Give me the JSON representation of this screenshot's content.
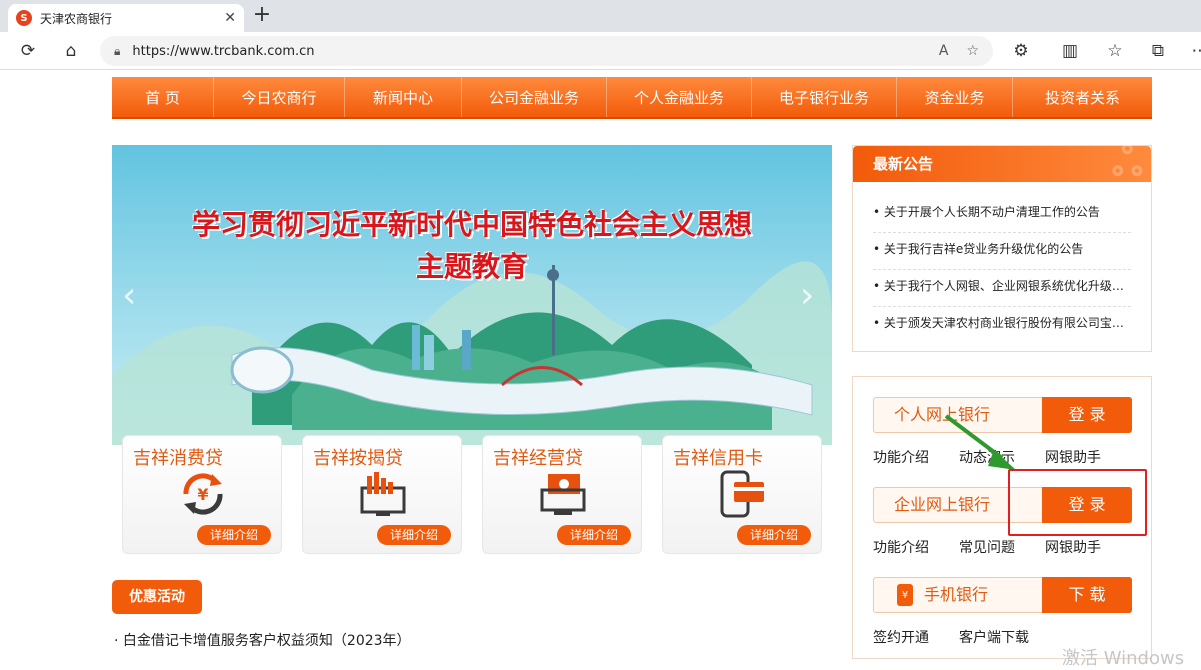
{
  "browser": {
    "tab_title": "天津农商银行",
    "url": "https://www.trcbank.com.cn",
    "icons": [
      "back-icon",
      "reload-icon",
      "home-icon",
      "lock-icon",
      "read-aloud-icon",
      "favorite-icon",
      "extensions-icon",
      "split-icon",
      "favorites-icon",
      "collections-icon"
    ]
  },
  "nav": {
    "items": [
      "首 页",
      "今日农商行",
      "新闻中心",
      "公司金融业务",
      "个人金融业务",
      "电子银行业务",
      "资金业务",
      "投资者关系"
    ]
  },
  "banner": {
    "title_line1": "学习贯彻习近平新时代中国特色社会主义思想",
    "title_line2": "主题教育"
  },
  "products": [
    {
      "name": "吉祥消费贷",
      "button": "详细介绍",
      "icon": "yen-cycle-icon"
    },
    {
      "name": "吉祥按揭贷",
      "button": "详细介绍",
      "icon": "building-monitor-icon"
    },
    {
      "name": "吉祥经营贷",
      "button": "详细介绍",
      "icon": "cash-register-icon"
    },
    {
      "name": "吉祥信用卡",
      "button": "详细介绍",
      "icon": "phone-card-icon"
    }
  ],
  "promo": {
    "tag": "优惠活动",
    "items": [
      "白金借记卡增值服务客户权益须知（2023年）"
    ]
  },
  "notice": {
    "title": "最新公告",
    "items": [
      "关于开展个人长期不动户清理工作的公告",
      "关于我行吉祥e贷业务升级优化的公告",
      "关于我行个人网银、企业网银系统优化升级…",
      "关于颁发天津农村商业银行股份有限公司宝…"
    ]
  },
  "login": {
    "personal": {
      "label": "个人网上银行",
      "button": "登 录",
      "links": [
        "功能介绍",
        "动态演示",
        "网银助手"
      ]
    },
    "corporate": {
      "label": "企业网上银行",
      "button": "登 录",
      "links": [
        "功能介绍",
        "常见问题",
        "网银助手"
      ]
    },
    "mobile": {
      "label": "手机银行",
      "button": "下 载",
      "links": [
        "签约开通",
        "客户端下载"
      ]
    }
  },
  "watermark": "激活 Windows",
  "colors": {
    "accent": "#f25b0a",
    "annotation": "#e02020",
    "arrow": "#2e9a2e"
  }
}
